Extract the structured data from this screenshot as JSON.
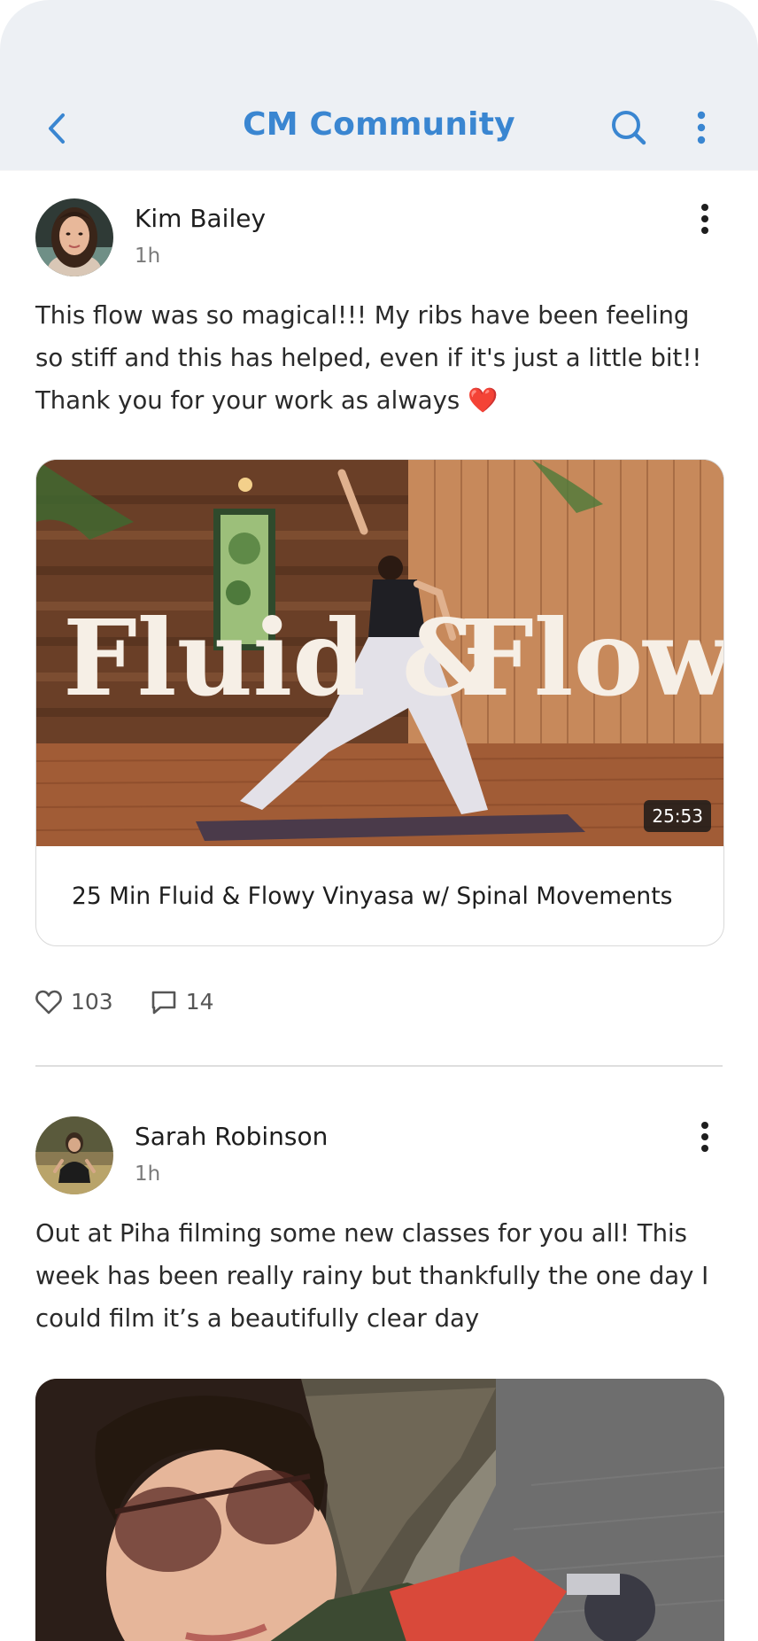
{
  "header": {
    "title": "CM Community",
    "back_icon": "chevron-left-icon",
    "search_icon": "search-icon",
    "more_icon": "more-vertical-icon",
    "accent_color": "#3a86d1",
    "background_color": "#edf0f4"
  },
  "posts": [
    {
      "author": "Kim Bailey",
      "time": "1h",
      "text": "This flow was so magical!!! My ribs have been feeling so stiff and this has helped, even if it's just a little bit!! Thank you for your work as always ❤️",
      "video": {
        "thumbnail_text_left": "Fluid &",
        "thumbnail_text_right": "Flowy",
        "duration": "25:53",
        "title": "25 Min Fluid & Flowy Vinyasa w/ Spinal Movements"
      },
      "likes": "103",
      "comments": "14"
    },
    {
      "author": "Sarah Robinson",
      "time": "1h",
      "text": "Out at Piha filming some new classes for you all! This week has been really rainy but thankfully the one day I could film it’s a beautifully clear day"
    }
  ]
}
